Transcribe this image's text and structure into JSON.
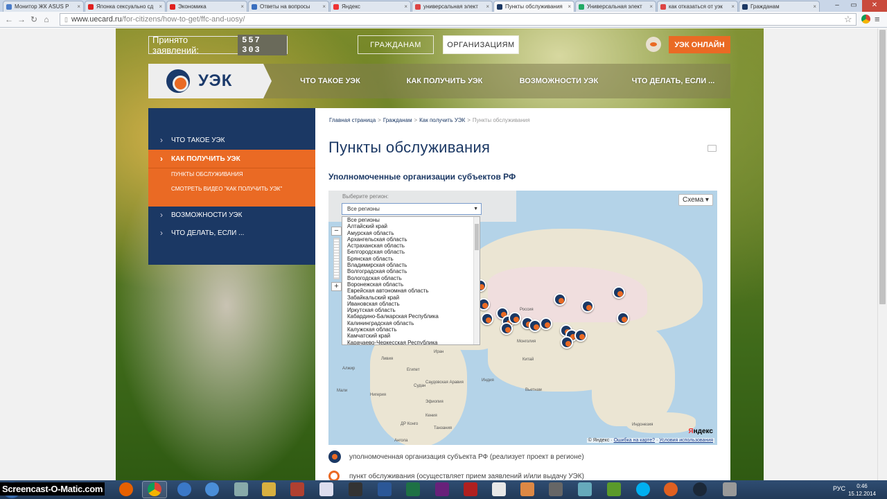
{
  "browser": {
    "tabs": [
      {
        "label": "Монитор ЖК ASUS P",
        "color": "#4a7cc9",
        "active": false
      },
      {
        "label": "Японка сексуально сд",
        "color": "#e02020",
        "active": false
      },
      {
        "label": "Экономика",
        "color": "#e02020",
        "active": false
      },
      {
        "label": "Ответы на вопросы",
        "color": "#3a6fbf",
        "active": false
      },
      {
        "label": "Яндекс",
        "color": "#e33",
        "active": false
      },
      {
        "label": "универсальная элект",
        "color": "#d44",
        "active": false
      },
      {
        "label": "Пункты обслуживания",
        "color": "#1b3864",
        "active": true
      },
      {
        "label": "Универсальная элект",
        "color": "#2a6",
        "active": false
      },
      {
        "label": "как отказаться от уэк",
        "color": "#d44",
        "active": false
      },
      {
        "label": "Гражданам",
        "color": "#1b3864",
        "active": false
      }
    ],
    "url_host": "www.uecard.ru",
    "url_path": "/for-citizens/how-to-get/ffc-and-uosy/"
  },
  "header": {
    "counter_label": "Принято заявлений:",
    "counter_value": "557 303",
    "toggle_citizens": "ГРАЖДАНАМ",
    "toggle_orgs": "ОРГАНИЗАЦИЯМ",
    "online_label": "УЭК ОНЛАЙН"
  },
  "nav": {
    "logo_text": "УЭК",
    "items": [
      "ЧТО ТАКОЕ УЭК",
      "КАК ПОЛУЧИТЬ УЭК",
      "ВОЗМОЖНОСТИ УЭК",
      "ЧТО ДЕЛАТЬ, ЕСЛИ ..."
    ]
  },
  "sidebar": {
    "items": [
      "ЧТО ТАКОЕ УЭК",
      "КАК ПОЛУЧИТЬ УЭК",
      "ВОЗМОЖНОСТИ УЭК",
      "ЧТО ДЕЛАТЬ, ЕСЛИ ..."
    ],
    "subitems": [
      "ПУНКТЫ ОБСЛУЖИВАНИЯ",
      "СМОТРЕТЬ ВИДЕО \"КАК ПОЛУЧИТЬ УЭК\""
    ]
  },
  "content": {
    "breadcrumbs": [
      "Главная страница",
      "Гражданам",
      "Как получить УЭК",
      "Пункты обслуживания"
    ],
    "title": "Пункты обслуживания",
    "subtitle": "Уполномоченные организации субъектов РФ",
    "map": {
      "region_label": "Выберите регион:",
      "region_selected": "Все регионы",
      "scheme_label": "Схема",
      "regions": [
        "Все регионы",
        "Алтайский край",
        "Амурская область",
        "Архангельская область",
        "Астраханская область",
        "Белгородская область",
        "Брянская область",
        "Владимирская область",
        "Волгоградская область",
        "Вологодская область",
        "Воронежская область",
        "Еврейская автономная область",
        "Забайкальский край",
        "Ивановская область",
        "Иркутская область",
        "Кабардино-Балкарская Республика",
        "Калининградская область",
        "Калужская область",
        "Камчатский край",
        "Карачаево-Черкесская Республика"
      ],
      "place_labels": [
        "Россия",
        "Монголия",
        "Китай",
        "Индия",
        "Египет",
        "Судан",
        "Эфиопия",
        "Кения",
        "Нигерия",
        "Иран",
        "Саудовская Аравия",
        "Ливия",
        "Алжир",
        "Мали",
        "Вьетнам",
        "Индонезия",
        "Танзания",
        "ДР Конго",
        "Ангола"
      ],
      "yandex_logo_red": "Я",
      "yandex_logo_rest": "ндекс",
      "footer_copy": "© Яндекс",
      "footer_link1": "Ошибка на карте?",
      "footer_link2": "Условия использования"
    },
    "legend": [
      "уполномоченная организация субъекта РФ (реализует проект в регионе)",
      "пункт обслуживания (осуществляет прием заявлений и/или выдачу УЭК)"
    ]
  },
  "taskbar": {
    "watermark": "Screencast-O-Matic.com",
    "lang": "РУС",
    "time": "0:46",
    "date": "15.12.2014"
  },
  "colors": {
    "brand_navy": "#1b3864",
    "brand_orange": "#ea6a24"
  }
}
